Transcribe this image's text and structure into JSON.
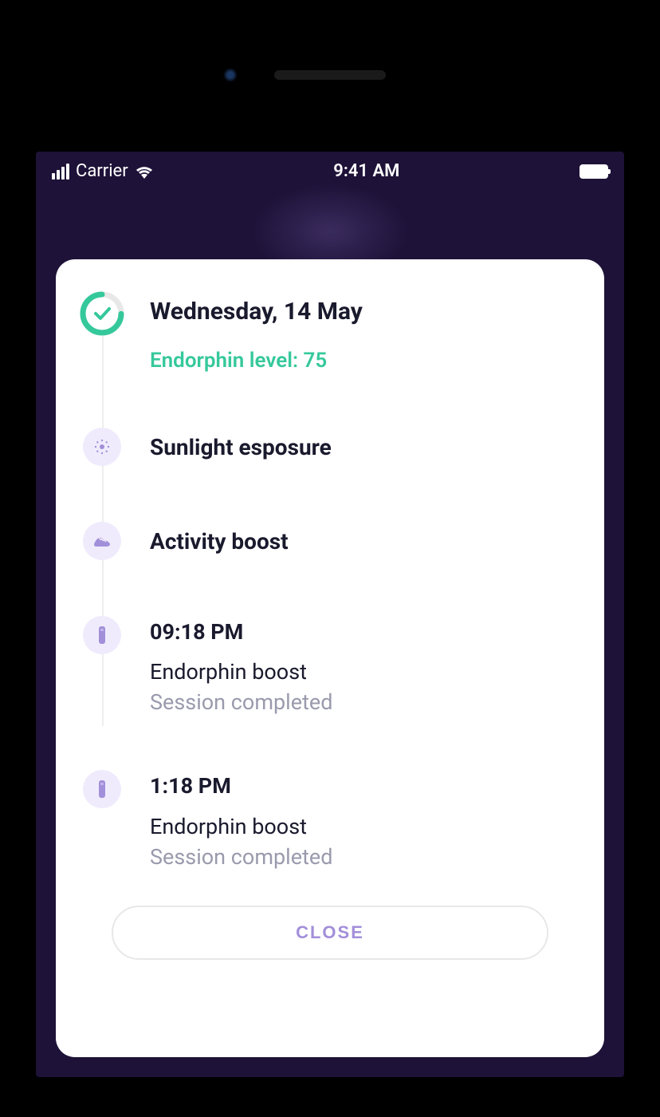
{
  "statusBar": {
    "carrier": "Carrier",
    "time": "9:41 AM"
  },
  "header": {
    "date": "Wednesday, 14 May",
    "endorphinLabel": "Endorphin level: 75"
  },
  "items": [
    {
      "title": "Sunlight esposure",
      "icon": "sun"
    },
    {
      "title": "Activity boost",
      "icon": "shoe"
    }
  ],
  "sessions": [
    {
      "time": "09:18 PM",
      "title": "Endorphin boost",
      "status": "Session completed"
    },
    {
      "time": "1:18 PM",
      "title": "Endorphin boost",
      "status": "Session completed"
    }
  ],
  "closeButton": "CLOSE"
}
